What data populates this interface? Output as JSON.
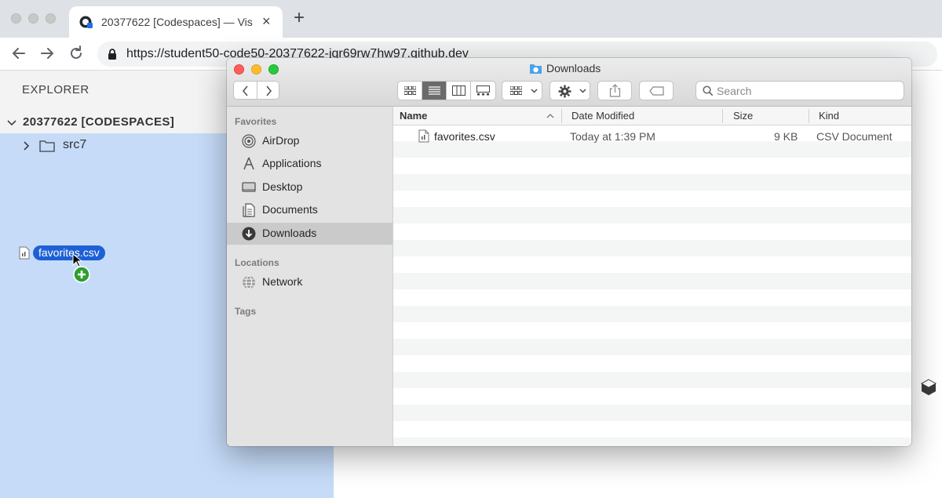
{
  "browser": {
    "tab_title": "20377622 [Codespaces] — Vis",
    "tab_close": "×",
    "new_tab": "+",
    "url": "https://student50-code50-20377622-jqr69rw7hw97.github.dev"
  },
  "explorer": {
    "title": "EXPLORER",
    "workspace": "20377622 [CODESPACES]",
    "folder": "src7",
    "drag_file": "favorites.csv"
  },
  "finder": {
    "title": "Downloads",
    "search_placeholder": "Search",
    "sidebar": {
      "favorites_heading": "Favorites",
      "favorites": [
        "AirDrop",
        "Applications",
        "Desktop",
        "Documents",
        "Downloads"
      ],
      "selected": "Downloads",
      "locations_heading": "Locations",
      "locations": [
        "Network"
      ],
      "tags_heading": "Tags"
    },
    "columns": {
      "name": "Name",
      "date": "Date Modified",
      "size": "Size",
      "kind": "Kind"
    },
    "files": [
      {
        "name": "favorites.csv",
        "date": "Today at 1:39 PM",
        "size": "9 KB",
        "kind": "CSV Document"
      }
    ]
  },
  "colors": {
    "drop_highlight": "#c5dbf8",
    "drag_chip": "#1d60d6",
    "close": "#ff5f57",
    "minimize": "#febc2e",
    "zoom": "#28c840"
  }
}
